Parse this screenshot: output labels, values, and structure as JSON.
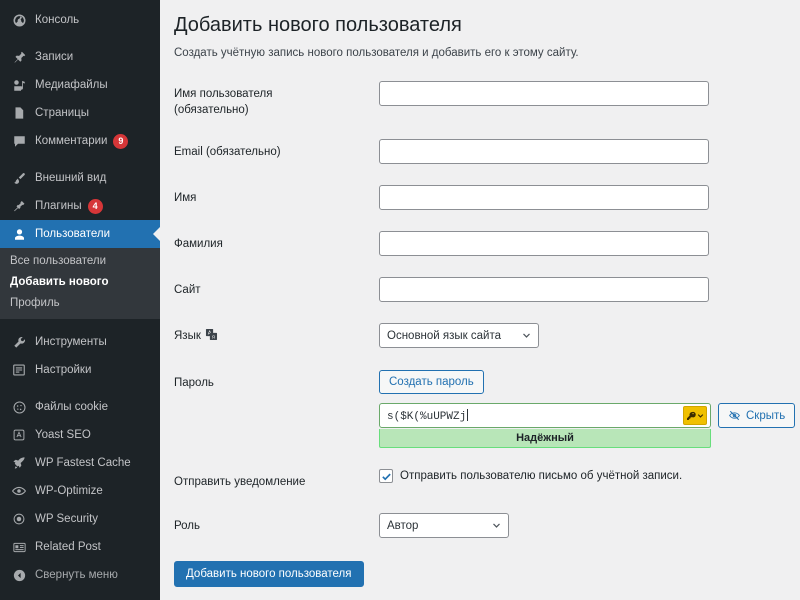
{
  "sidebar": {
    "items": [
      {
        "label": "Консоль",
        "icon": "dashboard-icon",
        "badge": null,
        "active": false
      },
      {
        "gap": true
      },
      {
        "label": "Записи",
        "icon": "pin-icon",
        "badge": null,
        "active": false
      },
      {
        "label": "Медиафайлы",
        "icon": "media-icon",
        "badge": null,
        "active": false
      },
      {
        "label": "Страницы",
        "icon": "pages-icon",
        "badge": null,
        "active": false
      },
      {
        "label": "Комментарии",
        "icon": "comment-icon",
        "badge": "9",
        "active": false
      },
      {
        "gap": true
      },
      {
        "label": "Внешний вид",
        "icon": "appearance-brush-icon",
        "badge": null,
        "active": false
      },
      {
        "label": "Плагины",
        "icon": "plugins-plug-icon",
        "badge": "4",
        "active": false
      },
      {
        "label": "Пользователи",
        "icon": "users-icon",
        "badge": null,
        "active": true
      }
    ],
    "submenu": [
      {
        "label": "Все пользователи",
        "current": false
      },
      {
        "label": "Добавить нового",
        "current": true
      },
      {
        "label": "Профиль",
        "current": false
      }
    ],
    "items_lower": [
      {
        "label": "Инструменты",
        "icon": "tools-wrench-icon",
        "badge": null
      },
      {
        "label": "Настройки",
        "icon": "settings-sliders-icon",
        "badge": null
      },
      {
        "gap": true
      },
      {
        "label": "Файлы cookie",
        "icon": "cookie-icon",
        "badge": null
      },
      {
        "label": "Yoast SEO",
        "icon": "yoast-seo-icon",
        "badge": null
      },
      {
        "label": "WP Fastest Cache",
        "icon": "fastest-cache-rocket-icon",
        "badge": null
      },
      {
        "label": "WP-Optimize",
        "icon": "wp-optimize-eye-icon",
        "badge": null
      },
      {
        "label": "WP Security",
        "icon": "wp-security-shield-icon",
        "badge": null
      },
      {
        "label": "Related Post",
        "icon": "related-post-list-icon",
        "badge": null
      }
    ],
    "collapse": {
      "label": "Свернуть меню",
      "icon": "collapse-arrow-icon"
    }
  },
  "main": {
    "title": "Добавить нового пользователя",
    "description": "Создать учётную запись нового пользователя и добавить его к этому сайту.",
    "fields": {
      "username": {
        "label_line1": "Имя пользователя",
        "label_line2": "(обязательно)",
        "value": "",
        "placeholder": ""
      },
      "email": {
        "label": "Email (обязательно)",
        "value": "",
        "placeholder": ""
      },
      "first_name": {
        "label": "Имя",
        "value": "",
        "placeholder": ""
      },
      "last_name": {
        "label": "Фамилия",
        "value": "",
        "placeholder": ""
      },
      "website": {
        "label": "Сайт",
        "value": "",
        "placeholder": ""
      },
      "language": {
        "label": "Язык",
        "icon": "translate-icon",
        "selected": "Основной язык сайта"
      },
      "password": {
        "label": "Пароль",
        "generate_button": "Создать пароль",
        "value": "s($K(%uUPWZj",
        "strength": "Надёжный",
        "hide_button": "Скрыть",
        "hide_icon": "eye-slash-icon",
        "key_icon": "key-dropdown-icon"
      },
      "notification": {
        "label": "Отправить уведомление",
        "checkbox_label": "Отправить пользователю письмо об учётной записи.",
        "checked": true
      },
      "role": {
        "label": "Роль",
        "selected": "Автор"
      }
    },
    "submit_button": "Добавить нового пользователя"
  },
  "colors": {
    "sidebar_bg": "#1d2327",
    "submenu_bg": "#32373c",
    "accent_blue": "#2271b1",
    "badge_red": "#d63638",
    "strength_green": "#b8e6b8",
    "key_yellow": "#f0c000",
    "content_bg": "#f0f0f1"
  }
}
